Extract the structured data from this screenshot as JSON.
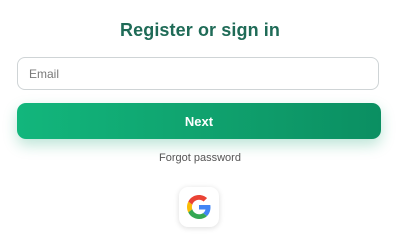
{
  "header": {
    "title": "Register or sign in"
  },
  "form": {
    "email_placeholder": "Email",
    "email_value": "",
    "next_label": "Next",
    "forgot_password_label": "Forgot password"
  },
  "social": {
    "google_icon": "google-g-icon"
  },
  "colors": {
    "title": "#1f6b57",
    "button_start": "#12b67c",
    "button_end": "#0b8f62"
  }
}
